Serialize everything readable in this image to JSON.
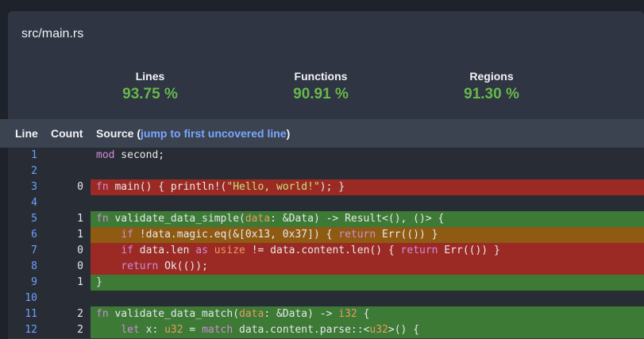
{
  "file": {
    "title": "src/main.rs"
  },
  "summary": [
    {
      "label": "Lines",
      "value": "93.75 %"
    },
    {
      "label": "Functions",
      "value": "90.91 %"
    },
    {
      "label": "Regions",
      "value": "91.30 %"
    }
  ],
  "table": {
    "col_line": "Line",
    "col_count": "Count",
    "col_source": "Source (",
    "jump_link": "jump to first uncovered line",
    "col_source_end": ")"
  },
  "colors": {
    "covered": "#3c7a35",
    "uncovered": "#9c2a24",
    "partial": "#8f5a12",
    "link": "#7aa7ff",
    "percent": "#68b84a"
  },
  "rows": [
    {
      "line": "1",
      "count": "",
      "status": "none",
      "source": "mod second;"
    },
    {
      "line": "2",
      "count": "",
      "status": "none",
      "source": ""
    },
    {
      "line": "3",
      "count": "0",
      "status": "uncovered",
      "source": "fn main() { println!(\"Hello, world!\"); }"
    },
    {
      "line": "4",
      "count": "",
      "status": "none",
      "source": ""
    },
    {
      "line": "5",
      "count": "1",
      "status": "covered",
      "source": "fn validate_data_simple(data: &Data) -> Result<(), ()> {"
    },
    {
      "line": "6",
      "count": "1",
      "status": "partial",
      "source": "    if !data.magic.eq(&[0x13, 0x37]) { return Err(()) }"
    },
    {
      "line": "7",
      "count": "0",
      "status": "uncovered",
      "source": "    if data.len as usize != data.content.len() { return Err(()) }"
    },
    {
      "line": "8",
      "count": "0",
      "status": "uncovered",
      "source": "    return Ok(());"
    },
    {
      "line": "9",
      "count": "1",
      "status": "covered",
      "source": "}"
    },
    {
      "line": "10",
      "count": "",
      "status": "none",
      "source": ""
    },
    {
      "line": "11",
      "count": "2",
      "status": "covered",
      "source": "fn validate_data_match(data: &Data) -> i32 {"
    },
    {
      "line": "12",
      "count": "2",
      "status": "covered",
      "source": "    let x: u32 = match data.content.parse::<u32>() {"
    }
  ]
}
